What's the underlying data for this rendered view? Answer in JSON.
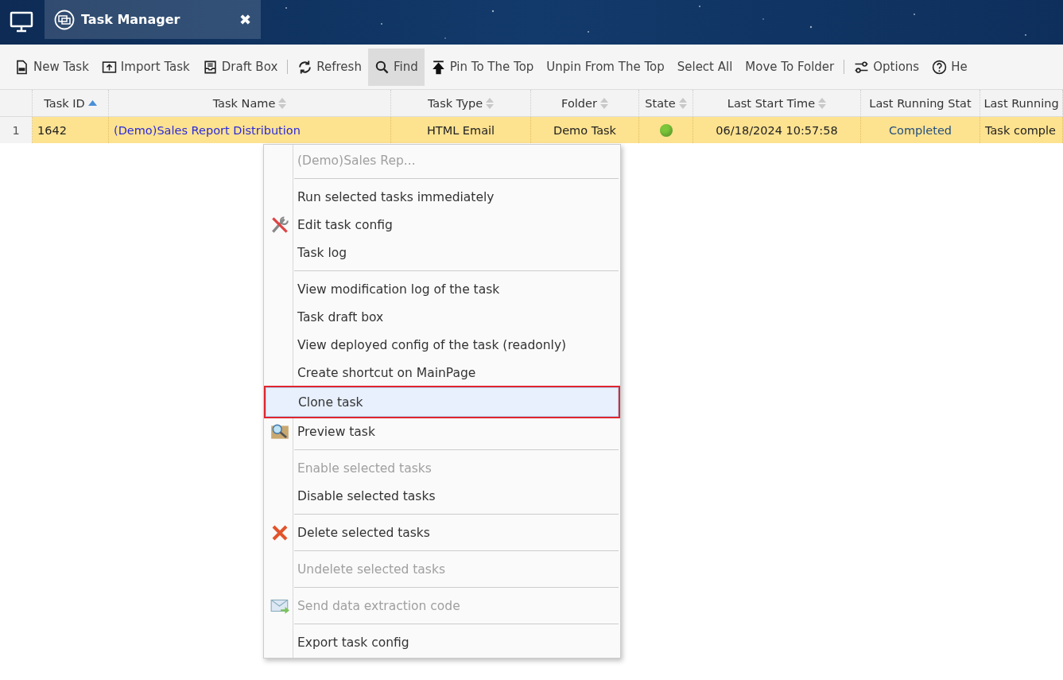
{
  "tab": {
    "title": "Task Manager",
    "close": "✖"
  },
  "toolbar": [
    {
      "kind": "new",
      "label": "New Task",
      "selected": false
    },
    {
      "kind": "import",
      "label": "Import Task",
      "selected": false
    },
    {
      "kind": "draft",
      "label": "Draft Box",
      "selected": false
    },
    {
      "kind": "divider"
    },
    {
      "kind": "refresh",
      "label": "Refresh",
      "selected": false
    },
    {
      "kind": "find",
      "label": "Find",
      "selected": true
    },
    {
      "kind": "pin",
      "label": "Pin To The Top",
      "selected": false
    },
    {
      "kind": "text",
      "label": "Unpin From The Top",
      "selected": false
    },
    {
      "kind": "text",
      "label": "Select All",
      "selected": false
    },
    {
      "kind": "text",
      "label": "Move To Folder",
      "selected": false
    },
    {
      "kind": "divider"
    },
    {
      "kind": "options",
      "label": "Options",
      "selected": false
    },
    {
      "kind": "help",
      "label": "He",
      "selected": false
    }
  ],
  "table": {
    "columns": [
      {
        "kind": "sorted",
        "label": "Task ID"
      },
      {
        "kind": "sortable",
        "label": "Task Name"
      },
      {
        "kind": "sortable",
        "label": "Task Type"
      },
      {
        "kind": "sortable",
        "label": "Folder"
      },
      {
        "kind": "sortable",
        "label": "State"
      },
      {
        "kind": "sortable",
        "label": "Last Start Time"
      },
      {
        "kind": "plain",
        "label": "Last Running Stat"
      },
      {
        "kind": "plain",
        "label": "Last Running"
      }
    ],
    "rows": [
      {
        "number": "1",
        "selected": true,
        "task_id": "1642",
        "task_name": "(Demo)Sales Report Distribution",
        "task_type": "HTML Email",
        "folder": "Demo Task",
        "state": {
          "color": "#7bc63a"
        },
        "last_start": "06/18/2024 10:57:58",
        "last_state": "Completed",
        "last_running": "Task comple"
      }
    ]
  },
  "context_menu": [
    {
      "kind": "title",
      "label": "(Demo)Sales Rep..."
    },
    {
      "kind": "separator"
    },
    {
      "kind": "item",
      "label": "Run selected tasks immediately",
      "disabled": false,
      "selected": false
    },
    {
      "kind": "tools",
      "label": "Edit task config",
      "disabled": false,
      "selected": false
    },
    {
      "kind": "item",
      "label": "Task log",
      "disabled": false,
      "selected": false
    },
    {
      "kind": "separator"
    },
    {
      "kind": "item",
      "label": "View modification log of the task",
      "disabled": false,
      "selected": false
    },
    {
      "kind": "item",
      "label": "Task draft box",
      "disabled": false,
      "selected": false
    },
    {
      "kind": "item",
      "label": "View deployed config of the task (readonly)",
      "disabled": false,
      "selected": false
    },
    {
      "kind": "item",
      "label": "Create shortcut on MainPage",
      "disabled": false,
      "selected": false
    },
    {
      "kind": "item",
      "label": "Clone task",
      "disabled": false,
      "selected": true
    },
    {
      "kind": "preview",
      "label": "Preview task",
      "disabled": false,
      "selected": false
    },
    {
      "kind": "separator"
    },
    {
      "kind": "item",
      "label": "Enable selected tasks",
      "disabled": true,
      "selected": false
    },
    {
      "kind": "item",
      "label": "Disable selected tasks",
      "disabled": false,
      "selected": false
    },
    {
      "kind": "separator"
    },
    {
      "kind": "delete",
      "label": "Delete selected tasks",
      "disabled": false,
      "selected": false
    },
    {
      "kind": "separator"
    },
    {
      "kind": "item",
      "label": "Undelete selected tasks",
      "disabled": true,
      "selected": false
    },
    {
      "kind": "separator"
    },
    {
      "kind": "mail",
      "label": "Send data extraction code",
      "disabled": true,
      "selected": false
    },
    {
      "kind": "separator"
    },
    {
      "kind": "item",
      "label": "Export task config",
      "disabled": false,
      "selected": false
    }
  ]
}
